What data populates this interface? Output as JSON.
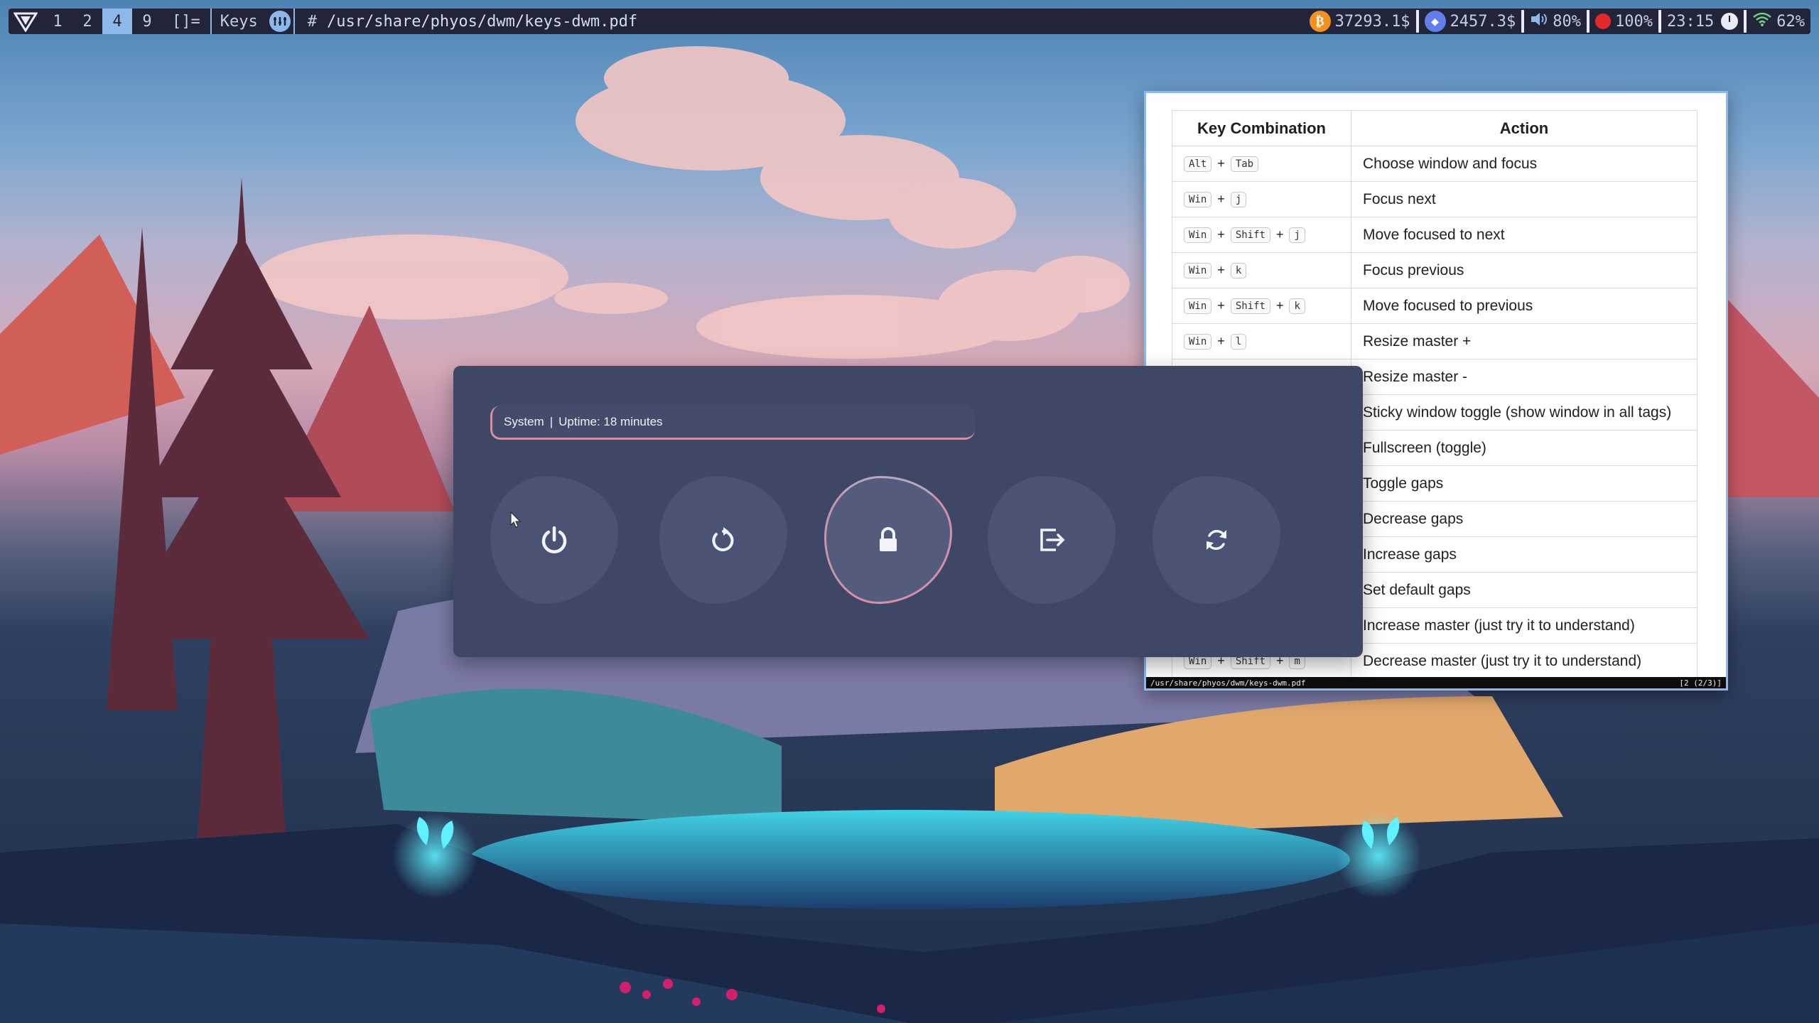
{
  "bar": {
    "tags": [
      "1",
      "2",
      "4",
      "9"
    ],
    "active_tag": "4",
    "layout": "[]=",
    "window_name": "Keys",
    "hash": "#",
    "window_title": "/usr/share/phyos/dwm/keys-dwm.pdf",
    "btc": "37293.1$",
    "btc_icon": "₿",
    "eth": "2457.3$",
    "eth_icon": "◆",
    "volume": "80%",
    "record": "100%",
    "time": "23:15",
    "wifi": "62%",
    "colors": {
      "bar_bg": "#222539",
      "accent": "#8eb8ea"
    }
  },
  "pdf": {
    "headers": {
      "keys": "Key Combination",
      "action": "Action"
    },
    "rows": [
      {
        "keys": [
          "Alt",
          "Tab"
        ],
        "action": "Choose window and focus"
      },
      {
        "keys": [
          "Win",
          "j"
        ],
        "action": "Focus next"
      },
      {
        "keys": [
          "Win",
          "Shift",
          "j"
        ],
        "action": "Move focused to next"
      },
      {
        "keys": [
          "Win",
          "k"
        ],
        "action": "Focus previous"
      },
      {
        "keys": [
          "Win",
          "Shift",
          "k"
        ],
        "action": "Move focused to previous"
      },
      {
        "keys": [
          "Win",
          "l"
        ],
        "action": "Resize master +"
      },
      {
        "keys": [],
        "action": "Resize master -"
      },
      {
        "keys": [],
        "action": "Sticky window toggle (show window in all tags)"
      },
      {
        "keys": [],
        "action": "Fullscreen (toggle)"
      },
      {
        "keys": [],
        "action": "Toggle gaps"
      },
      {
        "keys": [],
        "action": "Decrease gaps"
      },
      {
        "keys": [],
        "action": "Increase gaps"
      },
      {
        "keys": [],
        "action": "Set default gaps"
      },
      {
        "keys": [],
        "action": "Increase master (just try it to understand)"
      },
      {
        "keys": [
          "Win",
          "Shift",
          "m"
        ],
        "action": "Decrease master (just try it to understand)"
      }
    ],
    "status_left": "/usr/share/phyos/dwm/keys-dwm.pdf",
    "status_right": "[2 (2/3)]"
  },
  "power_menu": {
    "prompt_label": "System",
    "prompt_sep": "|",
    "uptime": "Uptime: 18 minutes",
    "buttons": [
      "power-icon",
      "restart-icon",
      "lock-icon",
      "logout-icon",
      "reload-icon"
    ],
    "selected": "lock-icon",
    "colors": {
      "bg": "#3f4766",
      "button": "#4b5374",
      "accent": "#d58fa6"
    }
  }
}
